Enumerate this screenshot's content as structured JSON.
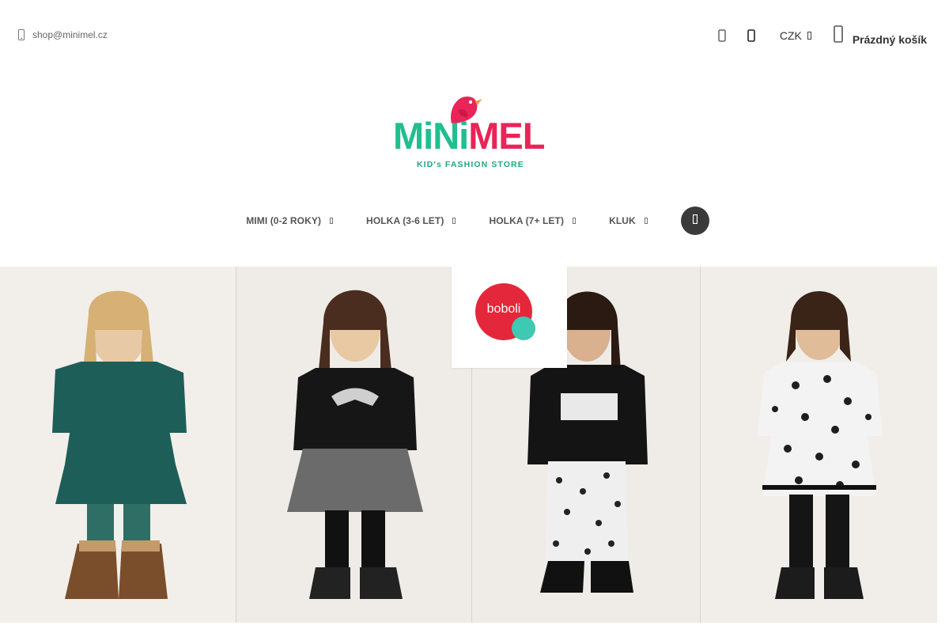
{
  "header": {
    "contact_email": "shop@minimel.cz",
    "currency": "CZK",
    "cart_label": "Prázdný košík",
    "icons": [
      "envelope-icon",
      "heart-icon",
      "user-icon",
      "chevron-down-icon",
      "shopping-bag-icon"
    ]
  },
  "logo": {
    "word_part1": "MiNi",
    "word_part2": "MEL",
    "tagline": "KID's FASHION STORE",
    "colors": {
      "green": "#1fbf8f",
      "pink": "#ea2458"
    }
  },
  "nav": {
    "items": [
      {
        "label": "MIMI (0-2 ROKY)"
      },
      {
        "label": "HOLKA (3-6 LET)"
      },
      {
        "label": "HOLKA (7+ LET)"
      },
      {
        "label": "KLUK"
      }
    ],
    "search_icon": "search-icon"
  },
  "hero": {
    "brand": "boboli",
    "brand_colors": {
      "red": "#e5273b",
      "teal": "#3ec9b2"
    },
    "panels": [
      {
        "name": "girl-teal-dress"
      },
      {
        "name": "girl-black-hoodie"
      },
      {
        "name": "girl-best-friends-top"
      },
      {
        "name": "girl-leopard-dress"
      }
    ]
  }
}
